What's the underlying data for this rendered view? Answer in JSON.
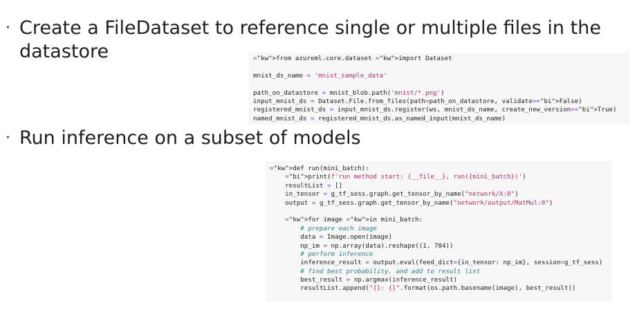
{
  "bullets": [
    {
      "line1": "Create a FileDataset to reference single or multiple files in the",
      "line2": "datastore"
    },
    {
      "line1": "Run inference on a subset of models"
    }
  ],
  "bullet_glyph": "·",
  "code_blocks": [
    {
      "lines": [
        "from azureml.core.dataset import Dataset",
        "",
        "mnist_ds_name = 'mnist_sample_data'",
        "",
        "path_on_datastore = mnist_blob.path('mnist/*.png')",
        "input_mnist_ds = Dataset.File.from_files(path=path_on_datastore, validate=False)",
        "registered_mnist_ds = input_mnist_ds.register(ws, mnist_ds_name, create_new_version=True)",
        "named_mnist_ds = registered_mnist_ds.as_named_input(mnist_ds_name)"
      ]
    },
    {
      "lines": [
        "def run(mini_batch):",
        "    print(f'run method start: {__file__}, run({mini_batch})')",
        "    resultList = []",
        "    in_tensor = g_tf_sess.graph.get_tensor_by_name(\"network/X:0\")",
        "    output = g_tf_sess.graph.get_tensor_by_name(\"network/output/MatMul:0\")",
        "",
        "    for image in mini_batch:",
        "        # prepare each image",
        "        data = Image.open(image)",
        "        np_im = np.array(data).reshape((1, 784))",
        "        # perform inference",
        "        inference_result = output.eval(feed_dict={in_tensor: np_im}, session=g_tf_sess)",
        "        # find best probability, and add to result list",
        "        best_result = np.argmax(inference_result)",
        "        resultList.append(\"{}: {}\".format(os.path.basename(image), best_result))"
      ]
    }
  ]
}
